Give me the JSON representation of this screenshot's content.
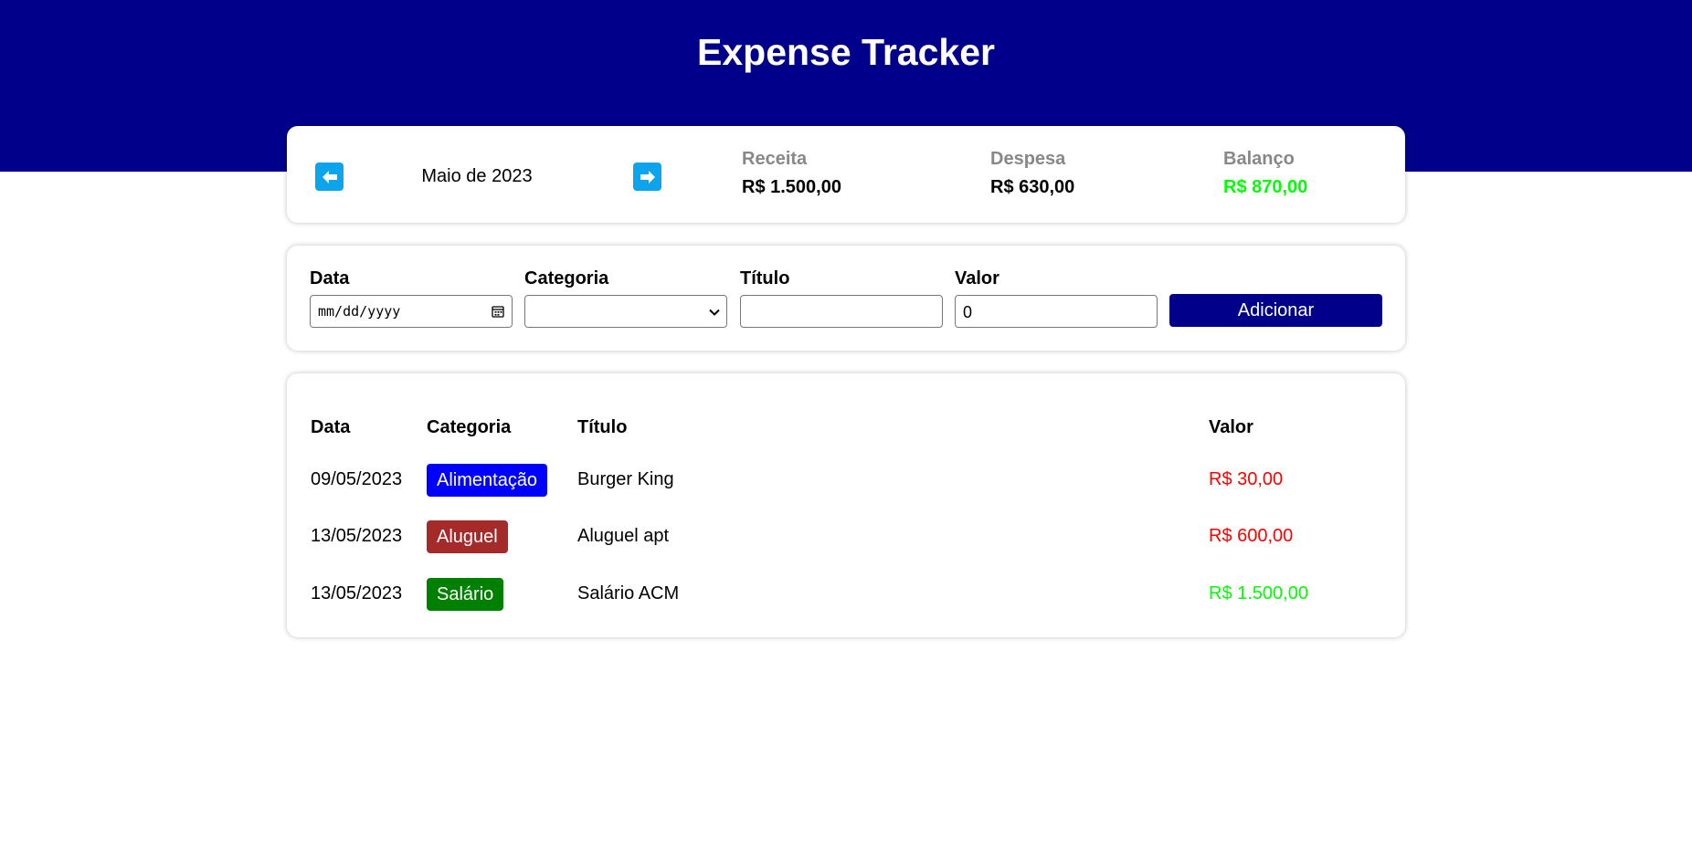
{
  "header": {
    "title": "Expense Tracker"
  },
  "info": {
    "month": "Maio de 2023",
    "prev_icon": "arrow-left-icon",
    "next_icon": "arrow-right-icon",
    "receita": {
      "label": "Receita",
      "value": "R$ 1.500,00"
    },
    "despesa": {
      "label": "Despesa",
      "value": "R$ 630,00"
    },
    "balanco": {
      "label": "Balanço",
      "value": "R$ 870,00",
      "color": "#00ff00"
    }
  },
  "form": {
    "data_label": "Data",
    "data_placeholder": "mm/dd/yyyy",
    "categoria_label": "Categoria",
    "categoria_value": "",
    "titulo_label": "Título",
    "titulo_value": "",
    "valor_label": "Valor",
    "valor_value": "0",
    "add_label": "Adicionar"
  },
  "table": {
    "headers": {
      "data": "Data",
      "categoria": "Categoria",
      "titulo": "Título",
      "valor": "Valor"
    },
    "rows": [
      {
        "data": "09/05/2023",
        "categoria": "Alimentação",
        "categoria_color": "#0000ff",
        "titulo": "Burger King",
        "valor": "R$ 30,00",
        "valor_color": "#ff0000"
      },
      {
        "data": "13/05/2023",
        "categoria": "Aluguel",
        "categoria_color": "#a52a2a",
        "titulo": "Aluguel apt",
        "valor": "R$ 600,00",
        "valor_color": "#ff0000"
      },
      {
        "data": "13/05/2023",
        "categoria": "Salário",
        "categoria_color": "#008000",
        "titulo": "Salário ACM",
        "valor": "R$ 1.500,00",
        "valor_color": "#00ff00"
      }
    ]
  },
  "colors": {
    "header_bg": "#00008b",
    "arrow_bg": "#0ca4ec",
    "button_bg": "#00008b"
  }
}
